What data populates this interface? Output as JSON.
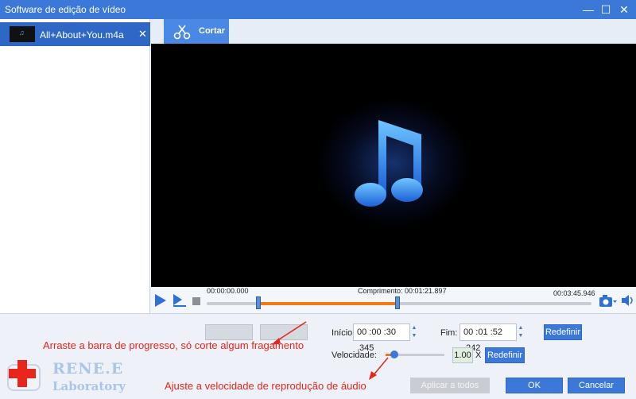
{
  "window": {
    "title": "Software de edição de vídeo",
    "minimize_icon": "—",
    "maximize_icon": "☐",
    "close_icon": "✕"
  },
  "sidebar": {
    "items": [
      {
        "name": "All+About+You.m4a",
        "close_icon": "✕"
      }
    ]
  },
  "tabs": [
    {
      "label": "Cortar",
      "icon": "scissors-icon"
    }
  ],
  "player": {
    "start_time": "00:00:00.000",
    "length_label": "Comprimento: 00:01:21.897",
    "end_time": "00:03:45.946",
    "selection": {
      "start_fraction": 0.133,
      "end_fraction": 0.496
    }
  },
  "trim": {
    "start_label": "Início:",
    "start_value": "00 :00 :30 .345",
    "end_label": "Fim:",
    "end_value": "00 :01 :52 .242",
    "reset_label": "Redefinir"
  },
  "speed": {
    "label": "Velocidade:",
    "value": "1.00",
    "unit": "X",
    "reset_label": "Redefinir",
    "level_fraction": 0.15
  },
  "annotations": {
    "progress_hint": "Arraste a barra de progresso, só corte algum fragamento",
    "speed_hint": "Ajuste a velocidade de reprodução de áudio"
  },
  "logo": {
    "line1": "RENE.E",
    "line2": "Laboratory"
  },
  "footer": {
    "apply_all": "Aplicar a todos",
    "ok": "OK",
    "cancel": "Cancelar"
  },
  "colors": {
    "titlebar": "#3b78d8",
    "accent_orange": "#f27a16",
    "annotation_red": "#e8261c",
    "selected_file": "#2f67c7"
  }
}
